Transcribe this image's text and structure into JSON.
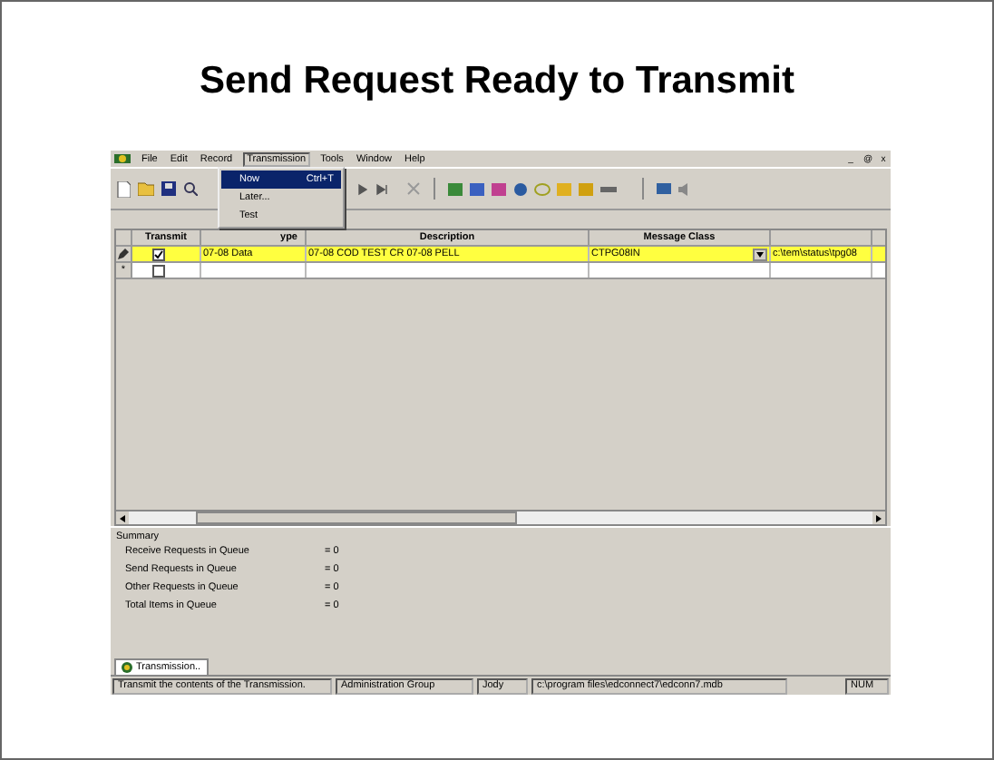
{
  "slide_title": "Send Request Ready to Transmit",
  "window": {
    "controls": [
      "_",
      "@",
      "x"
    ]
  },
  "menu": [
    {
      "label": "File",
      "open": false
    },
    {
      "label": "Edit",
      "open": false
    },
    {
      "label": "Record",
      "open": false
    },
    {
      "label": "Transmission",
      "open": true
    },
    {
      "label": "Tools",
      "open": false
    },
    {
      "label": "Window",
      "open": false
    },
    {
      "label": "Help",
      "open": false
    }
  ],
  "dropdown": [
    {
      "label": "Now",
      "shortcut": "Ctrl+T",
      "selected": true
    },
    {
      "label": "Later...",
      "selected": false
    },
    {
      "label": "Test",
      "selected": false
    }
  ],
  "grid": {
    "checkbox_column": {
      "label": "Transmit"
    },
    "columns": [
      {
        "label": "ype"
      },
      {
        "label": "Description"
      },
      {
        "label": "Message Class"
      },
      {}
    ],
    "rows": [
      {
        "kind": "editing",
        "transmit": true,
        "selected": true,
        "cells": [
          "07-08 Data",
          "07-08 COD TEST CR 07-08 PELL",
          "CTPG08IN",
          "c:\\tem\\status\\tpg08"
        ]
      },
      {
        "kind": "new",
        "marker": "*",
        "transmit": false,
        "selected": false,
        "cells": []
      }
    ]
  },
  "summary": {
    "title": "Summary",
    "items": [
      {
        "label": "Receive Requests in Queue",
        "value": "=  0"
      },
      {
        "label": "Send Requests in Queue",
        "value": "=  0"
      },
      {
        "label": "Other Requests in Queue",
        "value": "=  0"
      },
      {
        "label": "Total Items in Queue",
        "value": "=  0"
      }
    ]
  },
  "tabs": [
    {
      "label": "Transmission..",
      "selected": true
    }
  ],
  "status_bar": [
    "Transmit the contents of the Transmission.",
    "Administration Group",
    "Jody",
    "c:\\program files\\edconnect7\\edconn7.mdb",
    "NUM"
  ]
}
